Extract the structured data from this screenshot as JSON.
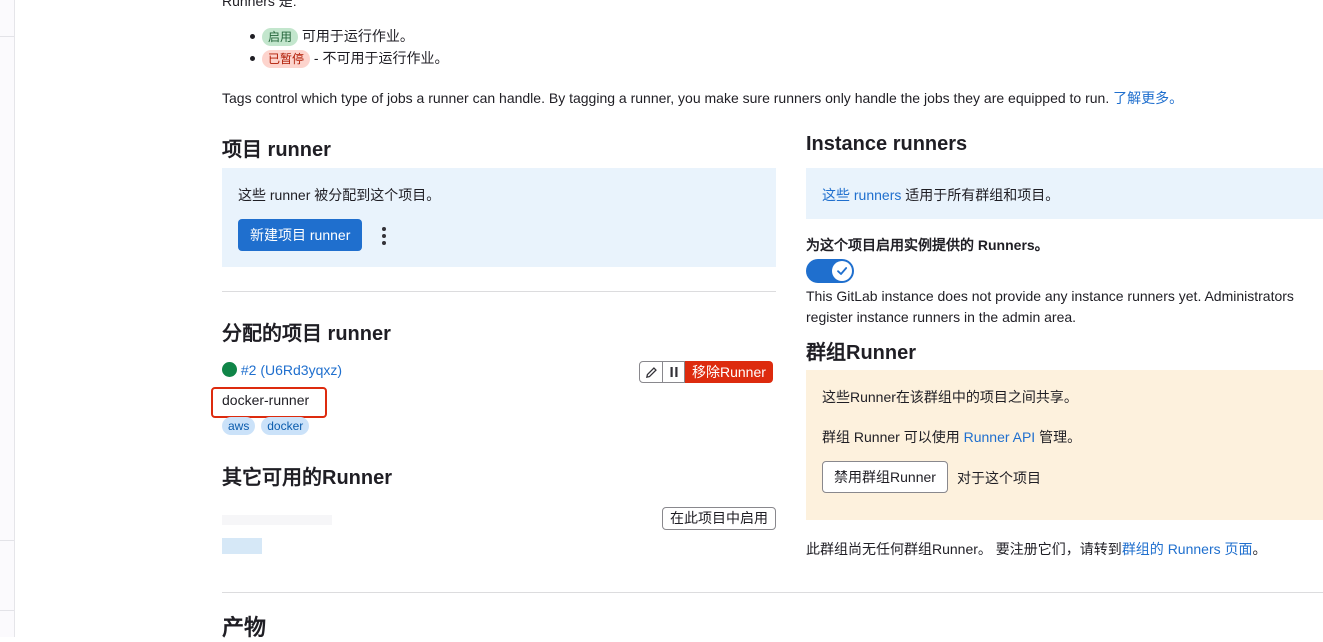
{
  "intro": {
    "top_cut": "Runners 是:",
    "items": [
      {
        "badge": "启用",
        "text": "可用于运行作业。"
      },
      {
        "badge": "已暂停",
        "text": "- 不可用于运行作业。"
      }
    ],
    "tags_text": "Tags control which type of jobs a runner can handle. By tagging a runner, you make sure runners only handle the jobs they are equipped to run.",
    "learn_more": "了解更多。"
  },
  "project_runners": {
    "title": "项目 runner",
    "panel_text": "这些 runner 被分配到这个项目。",
    "new_button": "新建项目 runner",
    "more_icon": "vertical-ellipsis-icon"
  },
  "assigned": {
    "title": "分配的项目 runner",
    "runner_id": "#2 (U6Rd3yqxz)",
    "runner_name": "docker-runner",
    "status_color": "#108548",
    "tags": [
      "aws",
      "docker"
    ],
    "edit_icon": "pencil-icon",
    "pause_icon": "pause-icon",
    "remove_button": "移除Runner"
  },
  "other": {
    "title": "其它可用的Runner",
    "enable_button": "在此项目中启用"
  },
  "instance": {
    "title": "Instance runners",
    "panel_link": "这些 runners",
    "panel_text": "适用于所有群组和项目。",
    "toggle_label": "为这个项目启用实例提供的 Runners。",
    "toggle_icon": "check-icon",
    "toggle_on": true,
    "note_line1": "This GitLab instance does not provide any instance runners yet. Administrators",
    "note_line2": "register instance runners in the admin area."
  },
  "group": {
    "title": "群组Runner",
    "line1": "这些Runner在该群组中的项目之间共享。",
    "line2_pre": "群组 Runner 可以使用",
    "line2_link": "Runner API",
    "line2_post": "管理。",
    "disable_button": "禁用群组Runner",
    "disable_suffix": "对于这个项目",
    "none_pre": "此群组尚无任何群组Runner。 要注册它们，请转到",
    "none_link": "群组的 Runners 页面",
    "none_post": "。"
  },
  "artifacts": {
    "title": "产物"
  },
  "colors": {
    "link": "#1f6fce",
    "primary": "#1f6fce",
    "danger": "#dd2b0e",
    "highlight_box": "#dd2b0e",
    "panel_blue": "#e9f3fc",
    "panel_orange": "#fdf1dd"
  }
}
